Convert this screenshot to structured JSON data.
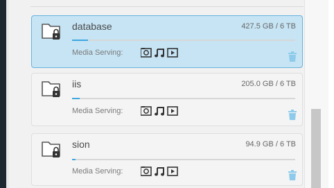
{
  "shares": [
    {
      "name": "database",
      "usage": "427.5 GB / 6 TB",
      "used_fraction": 0.07,
      "media_label": "Media Serving:",
      "media_icons": [
        "camera-icon",
        "music-note-icon",
        "video-play-icon"
      ],
      "selected": true
    },
    {
      "name": "iis",
      "usage": "205.0 GB / 6 TB",
      "used_fraction": 0.034,
      "media_label": "Media Serving:",
      "media_icons": [
        "camera-icon",
        "music-note-icon",
        "video-play-icon"
      ],
      "selected": false
    },
    {
      "name": "sion",
      "usage": "94.9 GB / 6 TB",
      "used_fraction": 0.016,
      "media_label": "Media Serving:",
      "media_icons": [
        "camera-icon",
        "music-note-icon",
        "video-play-icon"
      ],
      "selected": false
    }
  ],
  "colors": {
    "selected_bg": "#c6e4f4",
    "selected_border": "#66b3dd",
    "usage_fill": "#3da7e0",
    "trash": "#8ecbeb"
  }
}
